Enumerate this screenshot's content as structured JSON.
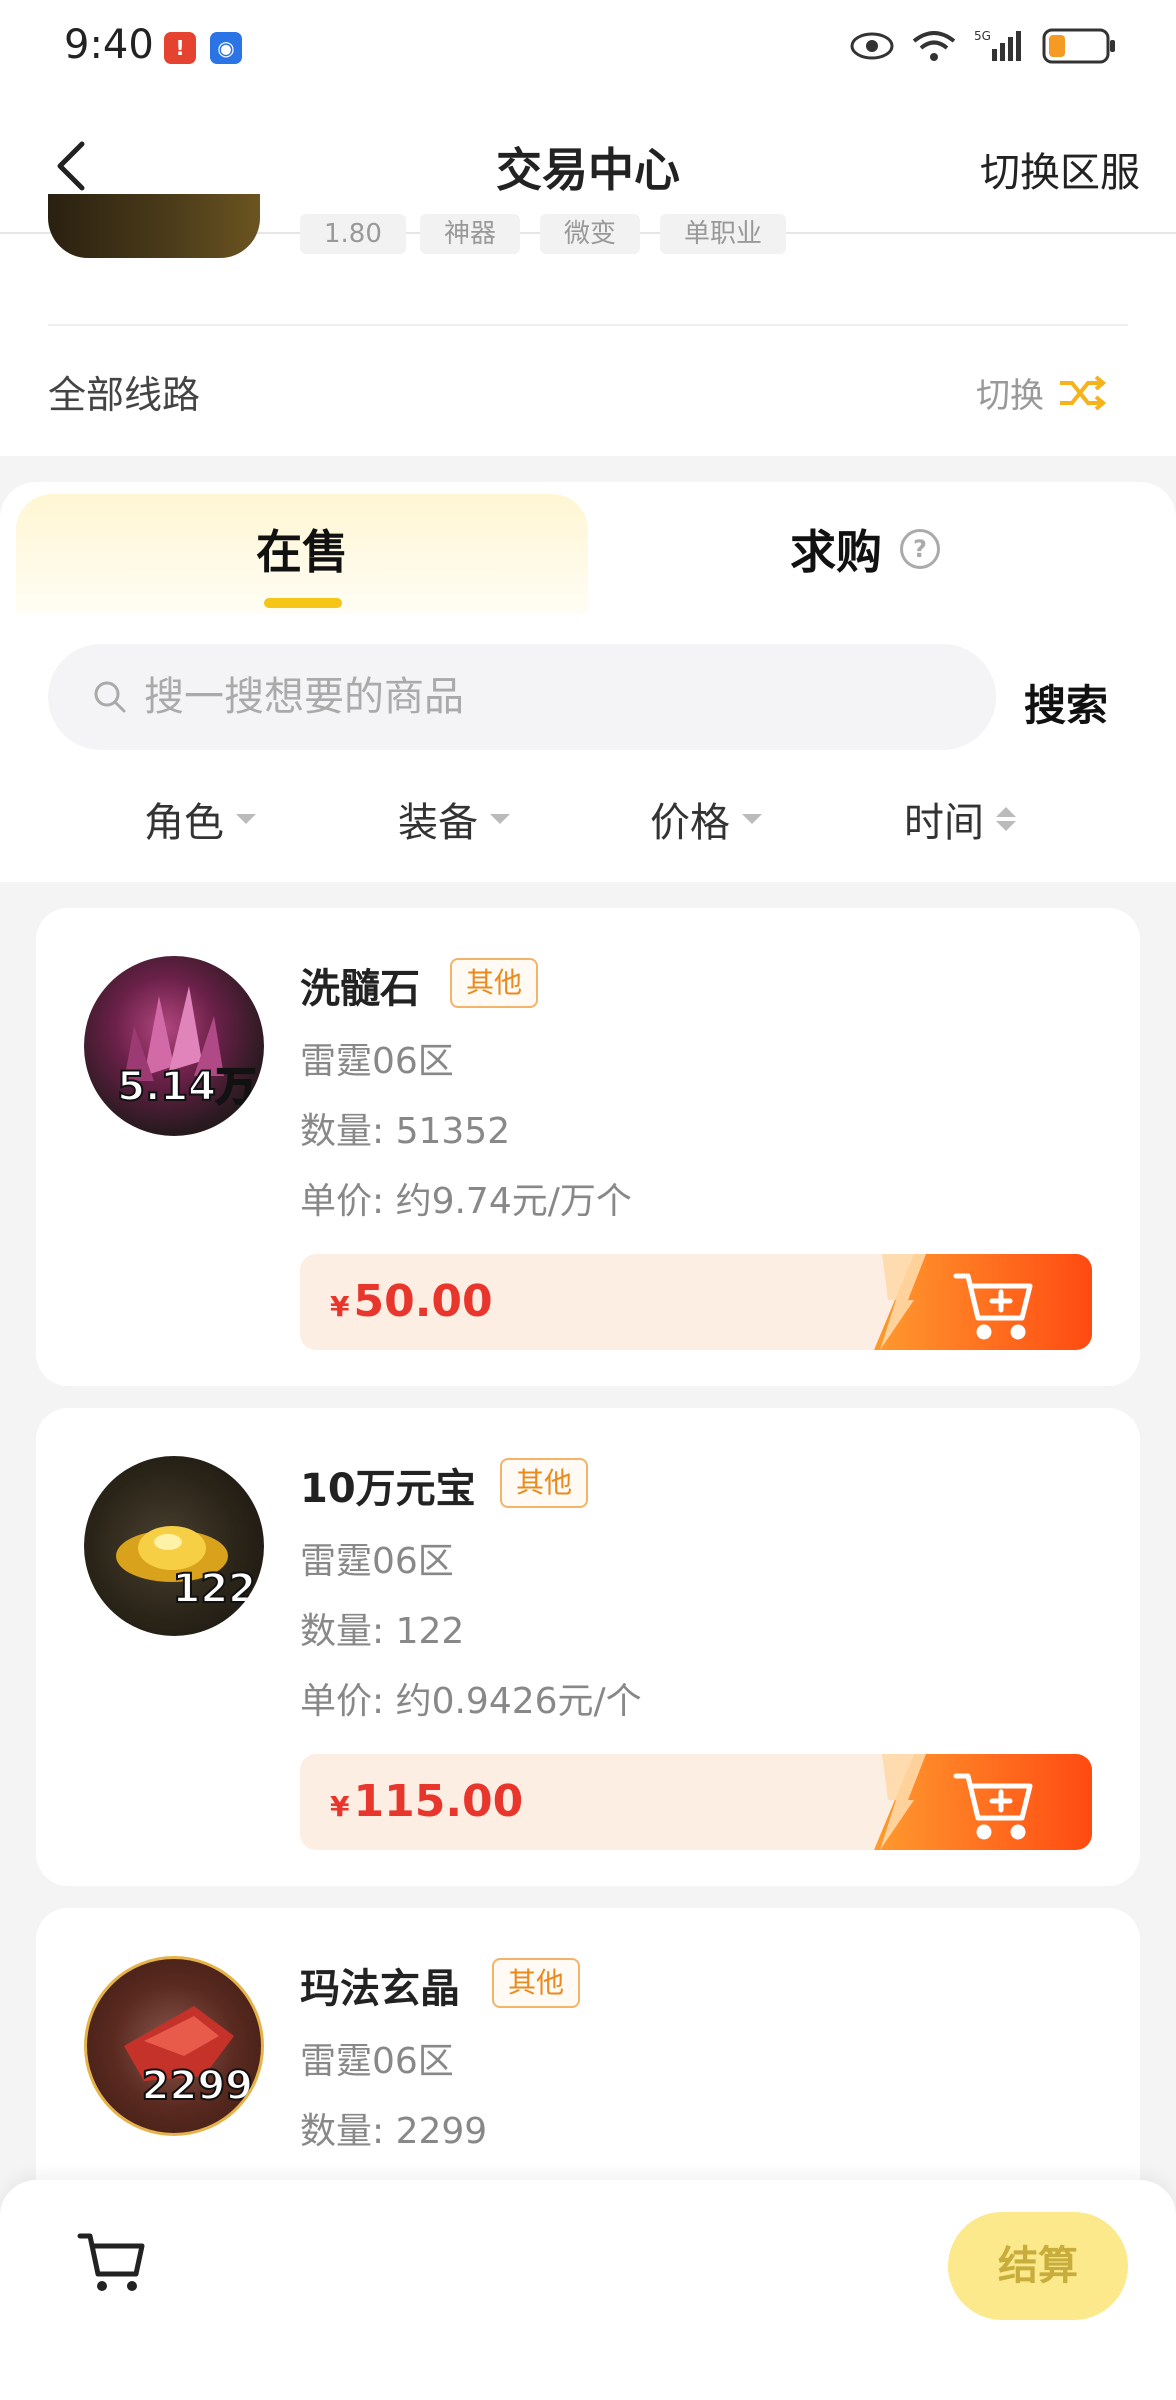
{
  "status_bar": {
    "time": "9:40"
  },
  "header": {
    "title": "交易中心",
    "switch_server": "切换区服"
  },
  "game": {
    "tags": [
      "1.80",
      "神器",
      "微变",
      "单职业"
    ],
    "route_label": "全部线路",
    "route_switch": "切换"
  },
  "tabs": {
    "sale": "在售",
    "buy": "求购"
  },
  "search": {
    "placeholder": "搜一搜想要的商品",
    "button": "搜索"
  },
  "filters": [
    "角色",
    "装备",
    "价格",
    "时间"
  ],
  "products": [
    {
      "name": "洗髓石",
      "tag": "其他",
      "server": "雷霆06区",
      "quantity": "数量: 51352",
      "unit_price": "单价: 约9.74元/万个",
      "currency": "¥",
      "price": "50.00",
      "thumb_qty": "5.14万"
    },
    {
      "name": "10万元宝",
      "tag": "其他",
      "server": "雷霆06区",
      "quantity": "数量: 122",
      "unit_price": "单价: 约0.9426元/个",
      "currency": "¥",
      "price": "115.00",
      "thumb_qty": "122"
    },
    {
      "name": "玛法玄晶",
      "tag": "其他",
      "server": "雷霆06区",
      "quantity": "数量: 2299",
      "thumb_qty": "2299"
    }
  ],
  "bottom": {
    "checkout": "结算"
  },
  "colors": {
    "accent_yellow": "#f5c518",
    "price_red": "#e8362c",
    "cart_orange": "#ff6a1a",
    "tag_orange": "#ea8a1d"
  },
  "icons": [
    "back-chevron-icon",
    "shuffle-icon",
    "help-icon",
    "search-icon",
    "add-to-cart-icon",
    "cart-icon"
  ]
}
